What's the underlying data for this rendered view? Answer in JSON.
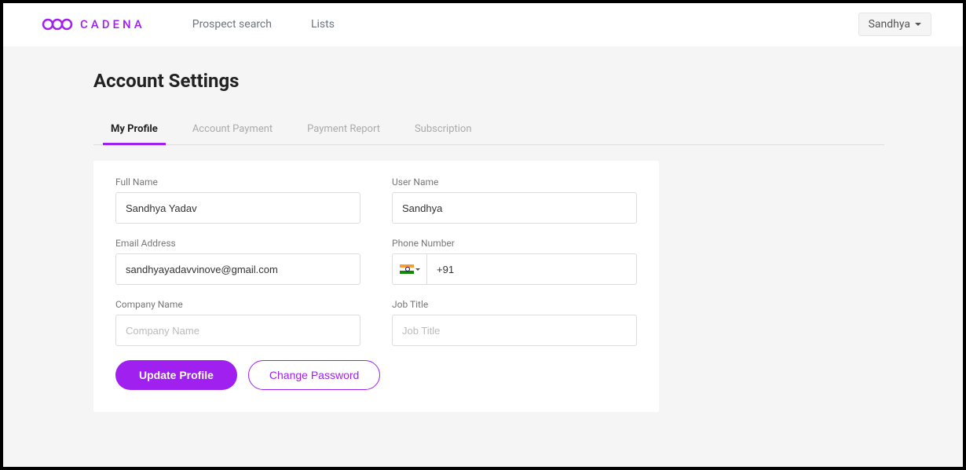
{
  "brand": {
    "name": "CADENA"
  },
  "nav": {
    "prospect_search": "Prospect search",
    "lists": "Lists"
  },
  "user": {
    "name": "Sandhya"
  },
  "page": {
    "title": "Account Settings"
  },
  "tabs": {
    "my_profile": "My Profile",
    "account_payment": "Account Payment",
    "payment_report": "Payment Report",
    "subscription": "Subscription"
  },
  "form": {
    "full_name": {
      "label": "Full Name",
      "value": "Sandhya Yadav"
    },
    "user_name": {
      "label": "User Name",
      "value": "Sandhya"
    },
    "email": {
      "label": "Email Address",
      "value": "sandhyayadavvinove@gmail.com"
    },
    "phone": {
      "label": "Phone Number",
      "dial_code": "+91",
      "value": "",
      "country": "IN"
    },
    "company": {
      "label": "Company Name",
      "value": "",
      "placeholder": "Company Name"
    },
    "job_title": {
      "label": "Job Title",
      "value": "",
      "placeholder": "Job Title"
    }
  },
  "buttons": {
    "update_profile": "Update Profile",
    "change_password": "Change Password"
  }
}
